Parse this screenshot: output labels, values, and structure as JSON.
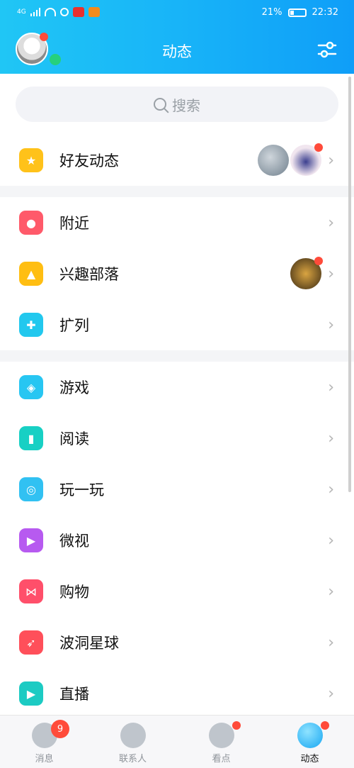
{
  "statusbar": {
    "network": "4G",
    "battery": "21%",
    "time": "22:32"
  },
  "header": {
    "title": "动态"
  },
  "search": {
    "placeholder": "搜索"
  },
  "sections": [
    [
      {
        "label": "好友动态",
        "icon": "star-icon",
        "color": "#ffc21a"
      }
    ],
    [
      {
        "label": "附近",
        "icon": "location-pin-icon",
        "color": "#ff5a6a"
      },
      {
        "label": "兴趣部落",
        "icon": "tent-icon",
        "color": "#ffbe12"
      },
      {
        "label": "扩列",
        "icon": "ghost-plus-icon",
        "color": "#22c8ee"
      }
    ],
    [
      {
        "label": "游戏",
        "icon": "gamepad-icon",
        "color": "#27c6f2"
      },
      {
        "label": "阅读",
        "icon": "book-icon",
        "color": "#18d0c4"
      },
      {
        "label": "玩一玩",
        "icon": "planet-icon",
        "color": "#31c1f2"
      },
      {
        "label": "微视",
        "icon": "play-icon",
        "color": "#b75af0"
      },
      {
        "label": "购物",
        "icon": "bow-icon",
        "color": "#ff4f6a"
      },
      {
        "label": "波洞星球",
        "icon": "rocket-icon",
        "color": "#ff4f5a"
      },
      {
        "label": "直播",
        "icon": "live-icon",
        "color": "#1ccbc3"
      }
    ]
  ],
  "tabs": [
    {
      "label": "消息",
      "badge": "9"
    },
    {
      "label": "联系人"
    },
    {
      "label": "看点"
    },
    {
      "label": "动态"
    }
  ]
}
